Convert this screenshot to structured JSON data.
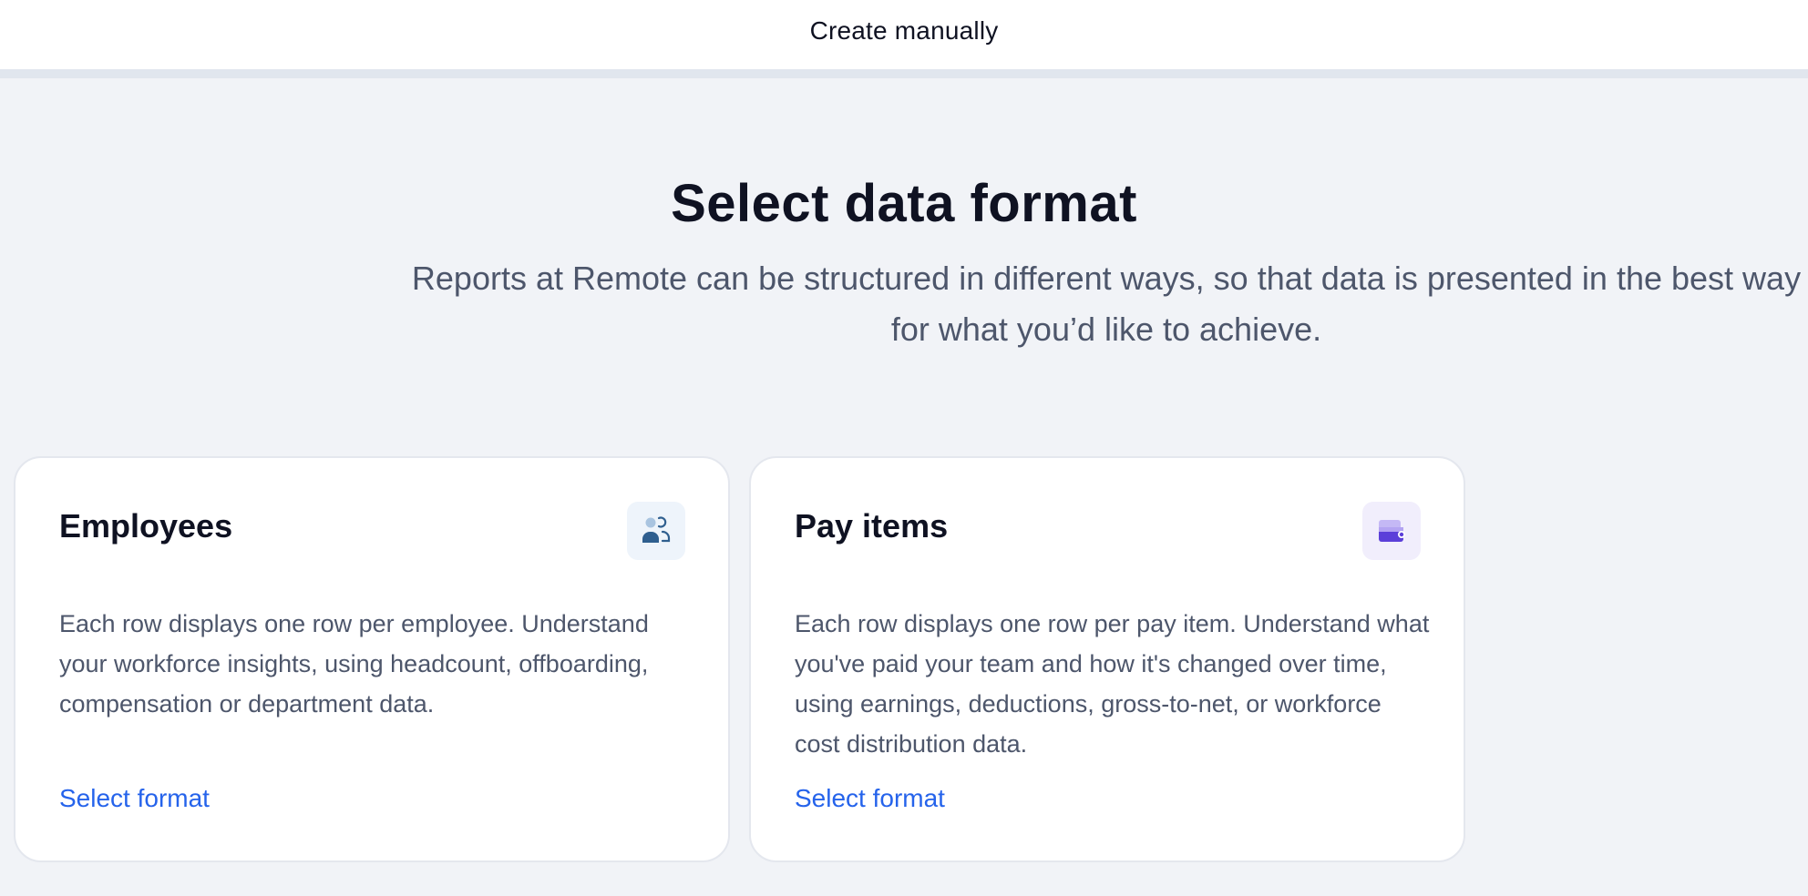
{
  "header": {
    "title": "Create manually"
  },
  "main": {
    "title": "Select data format",
    "subtitle": "Reports at Remote can be structured in different ways, so that data is presented in the best way for what you’d like to achieve."
  },
  "cards": [
    {
      "title": "Employees",
      "icon": "people-icon",
      "description": "Each row displays one row per employee. Understand your workforce insights, using headcount, offboarding, compensation or department data.",
      "link": "Select format"
    },
    {
      "title": "Pay items",
      "icon": "wallet-icon",
      "description": "Each row displays one row per pay item. Understand what you've paid your team and how it's changed over time, using earnings, deductions, gross-to-net, or workforce cost distribution data.",
      "link": "Select format"
    }
  ],
  "colors": {
    "background": "#f1f3f7",
    "card": "#ffffff",
    "link": "#2563eb",
    "text_muted": "#4d566b",
    "employees_icon": "#2f5f8f",
    "payitems_icon": "#5b3fd9"
  }
}
